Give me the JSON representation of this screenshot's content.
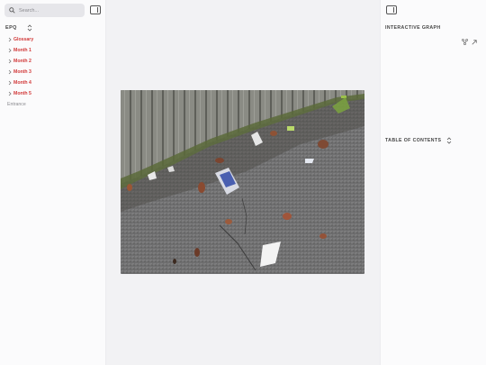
{
  "search": {
    "placeholder": "Search..."
  },
  "vault": {
    "name": "EPQ"
  },
  "file_tree": [
    {
      "label": "Glossary",
      "type": "folder"
    },
    {
      "label": "Month 1",
      "type": "folder"
    },
    {
      "label": "Month 2",
      "type": "folder"
    },
    {
      "label": "Month 3",
      "type": "folder"
    },
    {
      "label": "Month 4",
      "type": "folder"
    },
    {
      "label": "Month 5",
      "type": "folder"
    },
    {
      "label": "Entrance",
      "type": "file"
    }
  ],
  "right_panel": {
    "graph_title": "INTERACTIVE GRAPH",
    "toc_title": "TABLE OF CONTENTS"
  },
  "icons": {
    "search": "search-icon",
    "panel_toggle": "sidebar-toggle-icon",
    "sort": "sort-icon",
    "graph": "graph-icon",
    "expand": "expand-icon",
    "chevron": "chevron-right-icon"
  },
  "colors": {
    "folder_text": "#d23a3a",
    "file_text": "#8a8a8f",
    "sidebar_bg": "#fbfbfc",
    "main_bg": "#f2f2f4"
  }
}
